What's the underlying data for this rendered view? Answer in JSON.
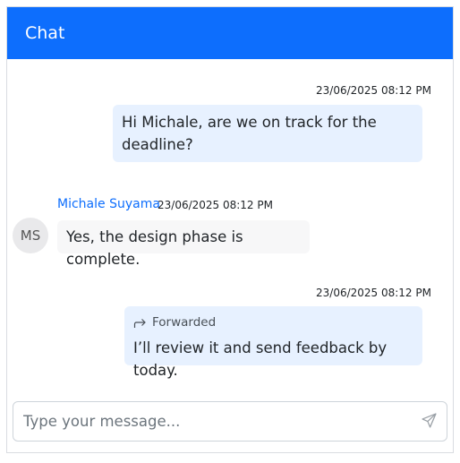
{
  "header": {
    "title": "Chat"
  },
  "messages": [
    {
      "direction": "outgoing",
      "timestamp": "23/06/2025 08:12 PM",
      "line1": "Hi Michale, are we on track for the",
      "line2": "deadline?"
    },
    {
      "direction": "incoming",
      "sender": "Michale Suyama",
      "avatar_initials": "MS",
      "timestamp": "23/06/2025 08:12 PM",
      "text": "Yes, the design phase is complete."
    },
    {
      "direction": "outgoing",
      "timestamp": "23/06/2025 08:12 PM",
      "forwarded_label": "Forwarded",
      "forwarded_icon": "forward-arrow-icon",
      "text": "I’ll review it and send feedback by today."
    }
  ],
  "composer": {
    "placeholder": "Type your message...",
    "value": "",
    "send_icon": "send-icon"
  },
  "colors": {
    "header_bg": "#0d6efd",
    "outgoing_bubble": "#e7f1ff",
    "incoming_bubble": "#f7f7f8",
    "sender_name": "#0d6efd"
  }
}
